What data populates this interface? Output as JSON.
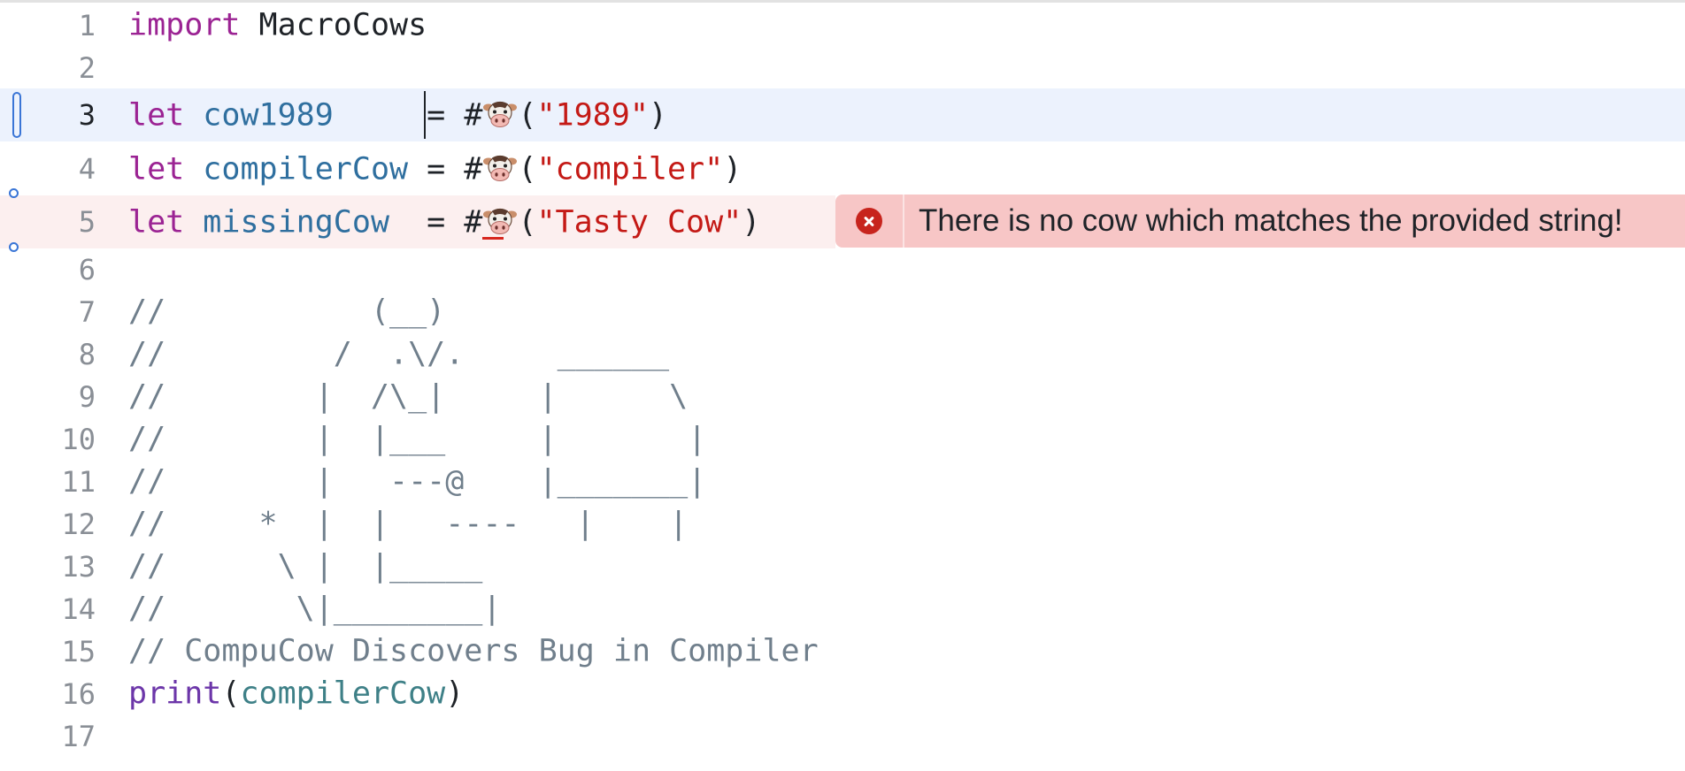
{
  "colors": {
    "keyword": "#9b2393",
    "identifier": "#2f6f9f",
    "string": "#c41a16",
    "comment": "#707f8c",
    "error": "#c7241d",
    "highlight": "#ecf2fd"
  },
  "lines": [
    {
      "num": "1",
      "parts": [
        {
          "t": "import",
          "c": "kw"
        },
        {
          "t": " MacroCows",
          "c": ""
        }
      ]
    },
    {
      "num": "2",
      "parts": []
    },
    {
      "num": "3",
      "parts": [
        {
          "t": "let",
          "c": "kw"
        },
        {
          "t": " ",
          "c": ""
        },
        {
          "t": "cow1989",
          "c": "var"
        },
        {
          "t": "     = #",
          "c": ""
        },
        {
          "emoji": "cow-face-icon"
        },
        {
          "t": "(",
          "c": ""
        },
        {
          "t": "\"1989\"",
          "c": "str"
        },
        {
          "t": ")",
          "c": ""
        }
      ]
    },
    {
      "num": "4",
      "parts": [
        {
          "t": "let",
          "c": "kw"
        },
        {
          "t": " ",
          "c": ""
        },
        {
          "t": "compilerCow",
          "c": "var"
        },
        {
          "t": " = #",
          "c": ""
        },
        {
          "emoji": "cow-face-icon"
        },
        {
          "t": "(",
          "c": ""
        },
        {
          "t": "\"compiler\"",
          "c": "str"
        },
        {
          "t": ")",
          "c": ""
        }
      ]
    },
    {
      "num": "5",
      "parts": [
        {
          "t": "let",
          "c": "kw"
        },
        {
          "t": " ",
          "c": ""
        },
        {
          "t": "missingCow",
          "c": "var"
        },
        {
          "t": "  = #",
          "c": ""
        },
        {
          "emoji": "cow-face-icon"
        },
        {
          "t": "(",
          "c": ""
        },
        {
          "t": "\"Tasty Cow\"",
          "c": "str"
        },
        {
          "t": ")",
          "c": ""
        }
      ]
    },
    {
      "num": "6",
      "parts": []
    },
    {
      "num": "7",
      "parts": [
        {
          "t": "//           (__)",
          "c": "cmt"
        }
      ]
    },
    {
      "num": "8",
      "parts": [
        {
          "t": "//         /  .\\/.     ______",
          "c": "cmt"
        }
      ]
    },
    {
      "num": "9",
      "parts": [
        {
          "t": "//        |  /\\_|     |      \\",
          "c": "cmt"
        }
      ]
    },
    {
      "num": "10",
      "parts": [
        {
          "t": "//        |  |___     |       |",
          "c": "cmt"
        }
      ]
    },
    {
      "num": "11",
      "parts": [
        {
          "t": "//        |   ---@    |_______|",
          "c": "cmt"
        }
      ]
    },
    {
      "num": "12",
      "parts": [
        {
          "t": "//     *  |  |   ----   |    |",
          "c": "cmt"
        }
      ]
    },
    {
      "num": "13",
      "parts": [
        {
          "t": "//      \\ |  |_____",
          "c": "cmt"
        }
      ]
    },
    {
      "num": "14",
      "parts": [
        {
          "t": "//       \\|________|",
          "c": "cmt"
        }
      ]
    },
    {
      "num": "15",
      "parts": [
        {
          "t": "// CompuCow Discovers Bug in Compiler",
          "c": "cmt"
        }
      ]
    },
    {
      "num": "16",
      "parts": [
        {
          "t": "print",
          "c": "fn"
        },
        {
          "t": "(",
          "c": ""
        },
        {
          "t": "compilerCow",
          "c": "ref"
        },
        {
          "t": ")",
          "c": ""
        }
      ]
    },
    {
      "num": "17",
      "parts": []
    }
  ],
  "error": {
    "message": "There is no cow which matches the provided string!",
    "icon": "error-x-icon"
  }
}
